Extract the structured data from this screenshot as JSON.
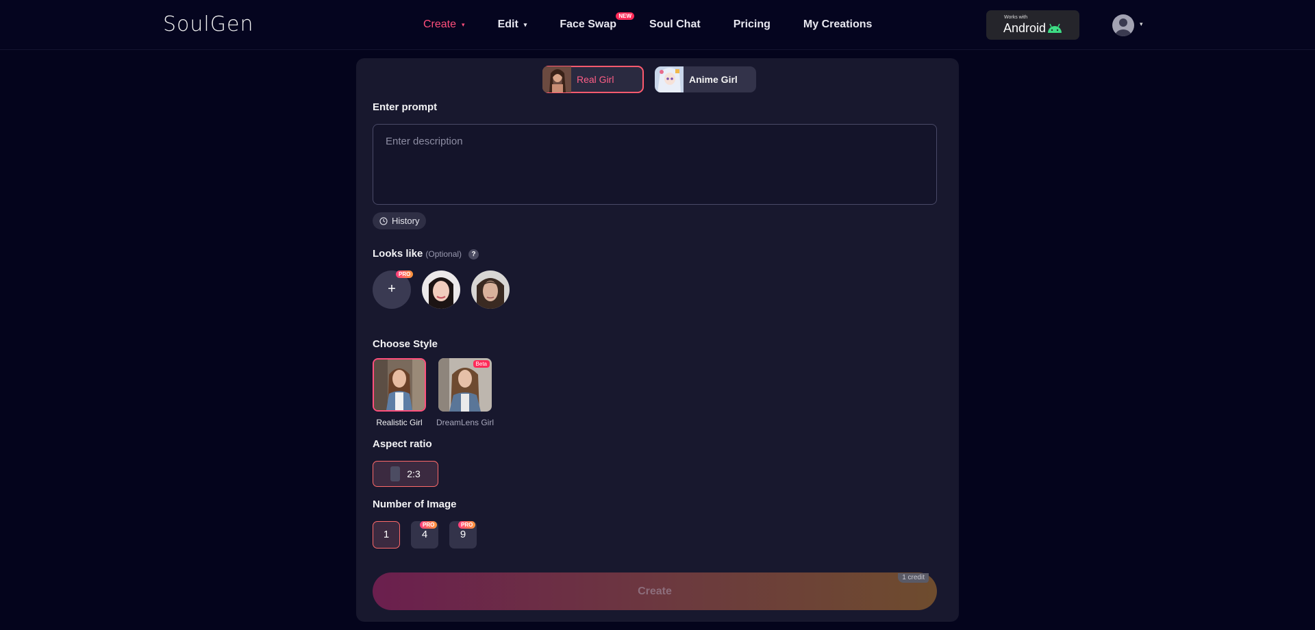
{
  "header": {
    "logo": "SoulGen",
    "nav": [
      {
        "label": "Create",
        "caret": "▾"
      },
      {
        "label": "Edit",
        "caret": "▾"
      },
      {
        "label": "Face Swap",
        "badge": "NEW"
      },
      {
        "label": "Soul Chat"
      },
      {
        "label": "Pricing"
      },
      {
        "label": "My Creations"
      }
    ],
    "android": {
      "works_with": "Works with",
      "label": "Android"
    },
    "avatar_caret": "▾"
  },
  "tabs": {
    "real": "Real Girl",
    "anime": "Anime Girl"
  },
  "prompt": {
    "title": "Enter prompt",
    "placeholder": "Enter description",
    "history": "History"
  },
  "looks_like": {
    "title": "Looks like",
    "optional": "(Optional)",
    "help": "?",
    "add": "+",
    "pro": "PRO"
  },
  "style": {
    "title": "Choose Style",
    "items": [
      {
        "label": "Realistic Girl",
        "selected": true
      },
      {
        "label": "DreamLens Girl",
        "badge": "Beta"
      }
    ]
  },
  "aspect": {
    "title": "Aspect ratio",
    "value": "2:3"
  },
  "number": {
    "title": "Number of Image",
    "options": [
      {
        "label": "1",
        "selected": true
      },
      {
        "label": "4",
        "badge": "PRO"
      },
      {
        "label": "9",
        "badge": "PRO"
      }
    ]
  },
  "create": {
    "label": "Create",
    "credit": "1 credit"
  },
  "colors": {
    "accent": "#ff4f7c",
    "background": "#04041c",
    "panel": "#18182e"
  }
}
